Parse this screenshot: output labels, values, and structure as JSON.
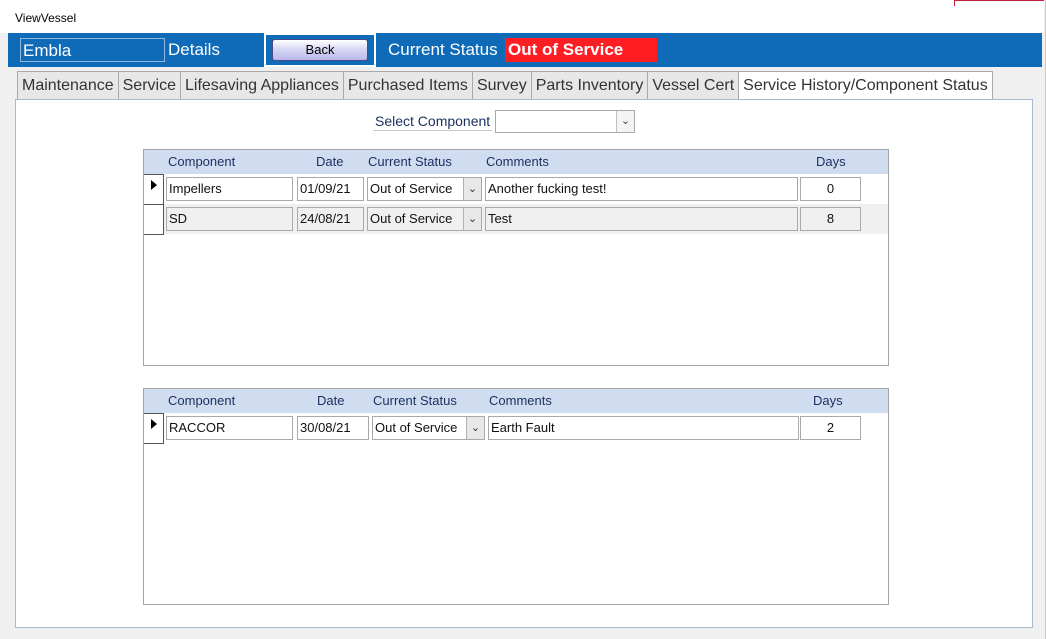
{
  "window": {
    "title": "ViewVessel"
  },
  "header": {
    "vessel_name": "Embla",
    "details_label": "Details",
    "back_label": "Back",
    "current_status_label": "Current Status",
    "current_status_value": "Out of Service",
    "status_color": "#ff1d24",
    "header_color": "#0f6bb8"
  },
  "tabs": [
    {
      "label": "Maintenance"
    },
    {
      "label": "Service"
    },
    {
      "label": "Lifesaving Appliances"
    },
    {
      "label": "Purchased Items"
    },
    {
      "label": "Survey"
    },
    {
      "label": "Parts Inventory"
    },
    {
      "label": "Vessel Cert"
    },
    {
      "label": "Service History/Component Status",
      "active": true
    }
  ],
  "filter": {
    "label": "Select Component",
    "value": ""
  },
  "grid1": {
    "columns": [
      "Component",
      "Date",
      "Current Status",
      "Comments",
      "Days"
    ],
    "rows": [
      {
        "component": "Impellers",
        "date": "01/09/21",
        "status": "Out of Service",
        "comments": "Another fucking test!",
        "days": "0"
      },
      {
        "component": "SD",
        "date": "24/08/21",
        "status": "Out of Service",
        "comments": "Test",
        "days": "8"
      }
    ]
  },
  "grid2": {
    "columns": [
      "Component",
      "Date",
      "Current Status",
      "Comments",
      "Days"
    ],
    "rows": [
      {
        "component": "RACCOR",
        "date": "30/08/21",
        "status": "Out of Service",
        "comments": "Earth Fault",
        "days": "2"
      }
    ]
  }
}
